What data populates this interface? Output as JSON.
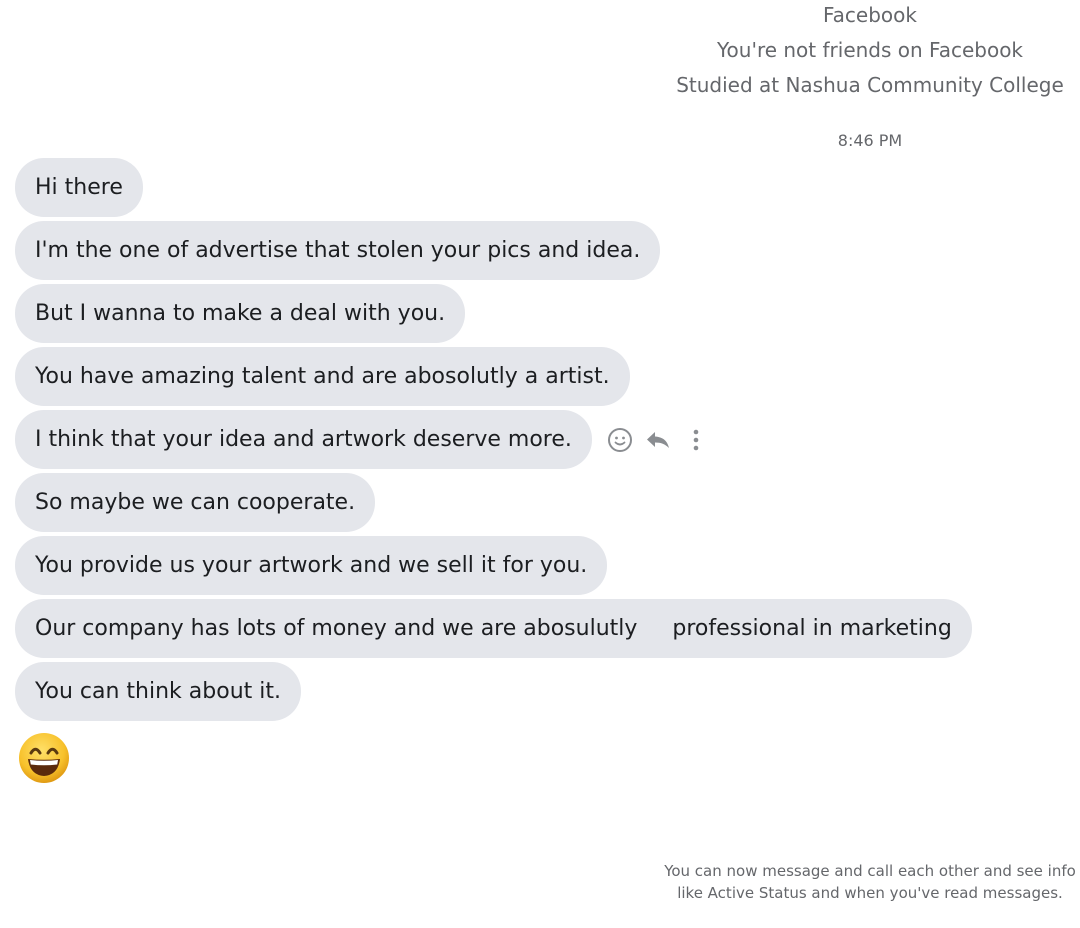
{
  "profile": {
    "lines": [
      "Facebook",
      "You're not friends on Facebook",
      "Studied at Nashua Community College"
    ]
  },
  "timestamp": "8:46 PM",
  "messages": [
    {
      "text": "Hi there"
    },
    {
      "text": "I'm the one of advertise that stolen your pics and idea."
    },
    {
      "text": "But I wanna to make a deal with you."
    },
    {
      "text": "You have amazing talent and are abosolutly a artist."
    },
    {
      "text": "I think that your idea and artwork deserve more.",
      "hovered": true
    },
    {
      "text": "So maybe we can cooperate."
    },
    {
      "text": "You provide us your artwork and we sell it for you."
    },
    {
      "text": "Our company has lots of money and we are abosulutly     professional in marketing"
    },
    {
      "text": "You can think about it."
    }
  ],
  "emoji_message": {
    "icon": "grinning-smiling-eyes-emoji"
  },
  "message_actions": {
    "icons": [
      "react-smiley-icon",
      "reply-icon",
      "more-options-icon"
    ]
  },
  "notice": {
    "text": "You can now message and call each other and see info like Active Status and when you've read messages."
  },
  "colors": {
    "bubble_background": "#e4e6eb",
    "secondary_text": "#65676b",
    "icon_gray": "#8a8d91"
  }
}
